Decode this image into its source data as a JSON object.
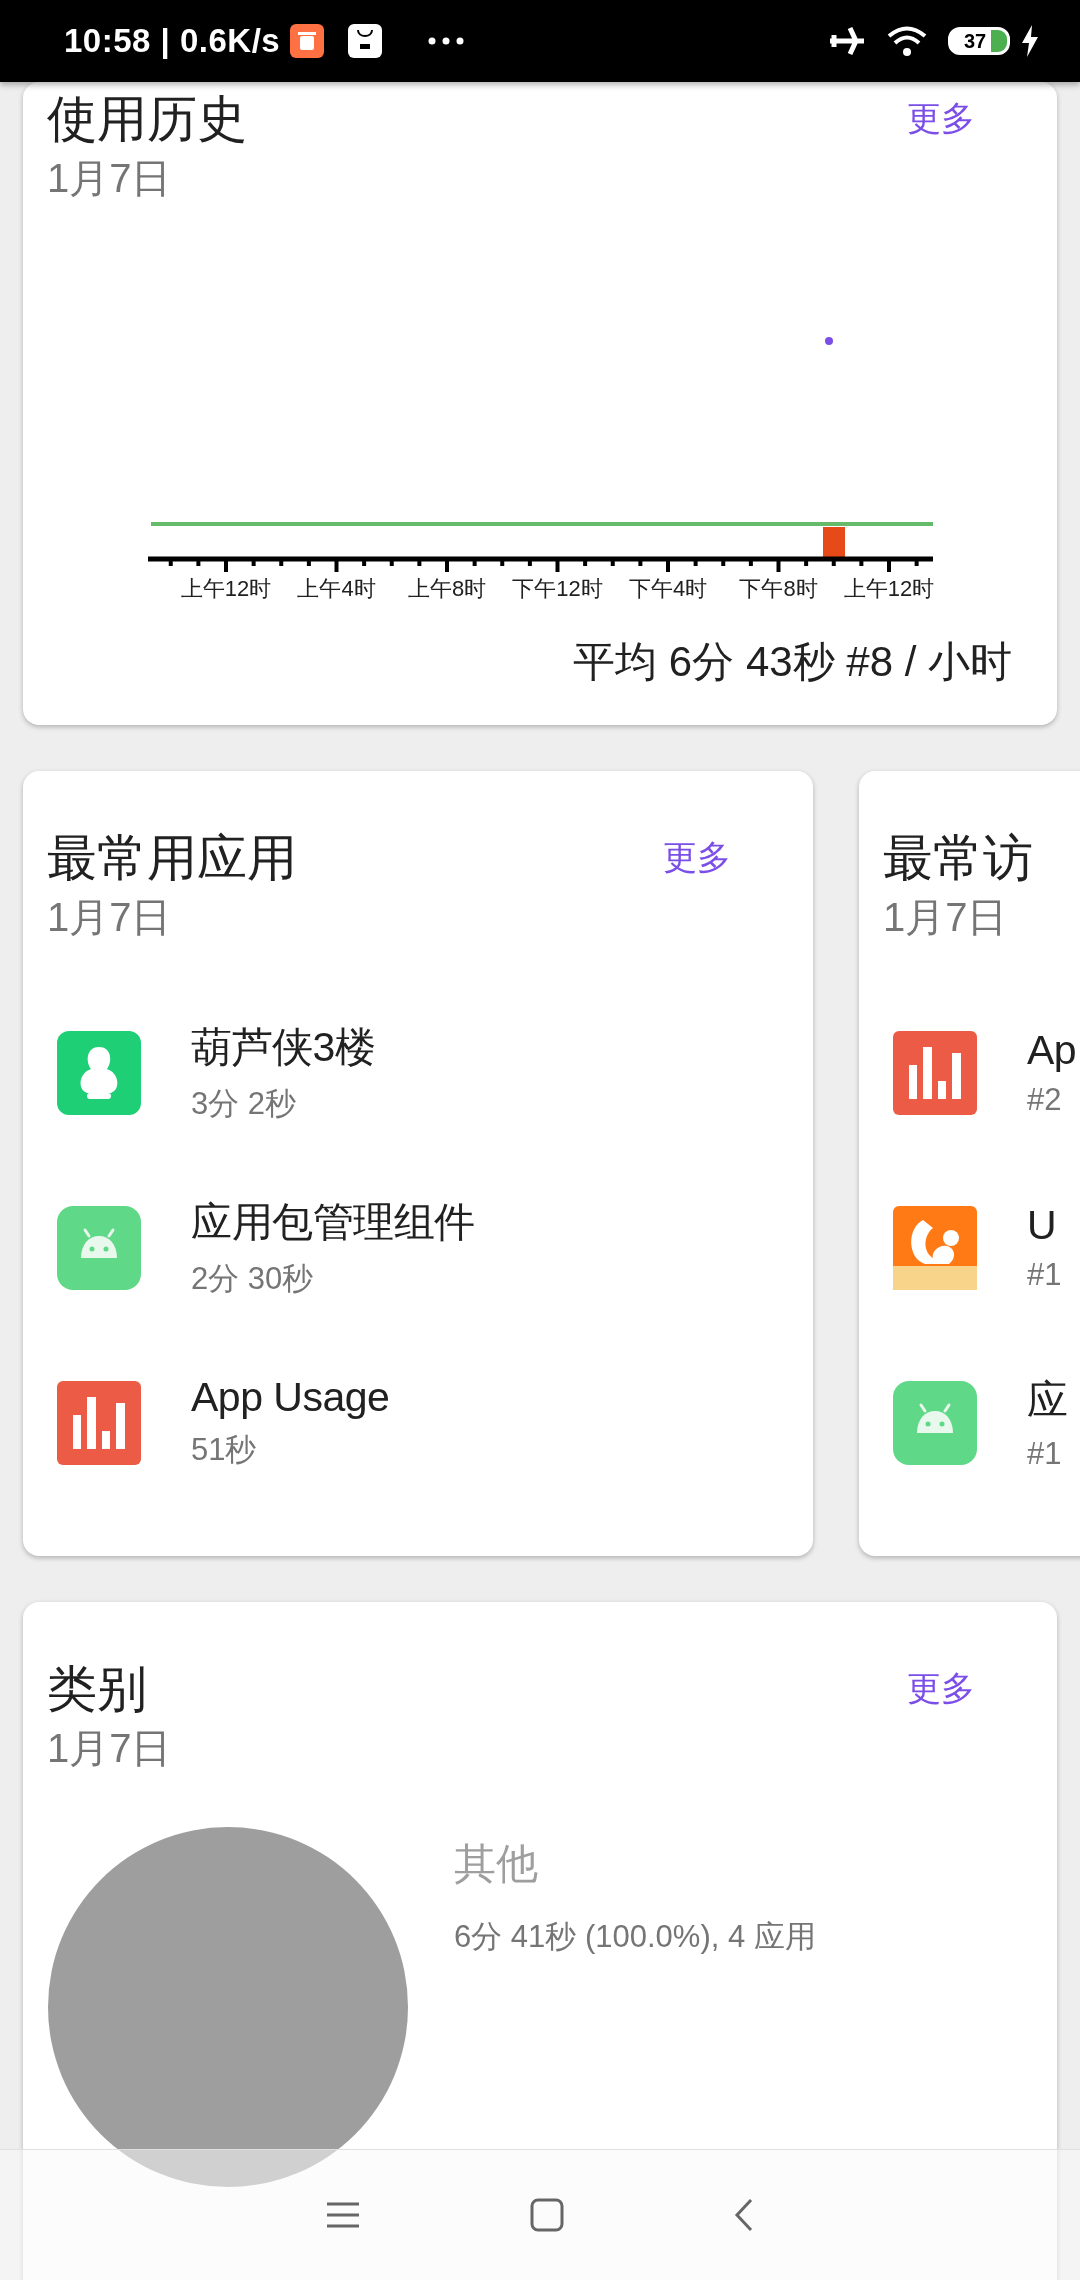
{
  "status_bar": {
    "text": "10:58 | 0.6K/s",
    "battery": "37"
  },
  "usage_history": {
    "title": "使用历史",
    "more": "更多",
    "date": "1月7日",
    "tick_labels": [
      "上午12时",
      "上午4时",
      "上午8时",
      "下午12时",
      "下午4时",
      "下午8时",
      "上午12时"
    ],
    "average": "平均 6分 43秒 #8 / 小时"
  },
  "cards": [
    {
      "title": "最常用应用",
      "more": "更多",
      "date": "1月7日",
      "apps": [
        {
          "kind": "gourd",
          "name": "葫芦侠3楼",
          "detail": "3分 2秒"
        },
        {
          "kind": "android",
          "name": "应用包管理组件",
          "detail": "2分 30秒"
        },
        {
          "kind": "bars",
          "name": "App Usage",
          "detail": "51秒"
        }
      ]
    },
    {
      "title": "最常访",
      "date": "1月7日",
      "apps": [
        {
          "kind": "bars",
          "name": "Ap",
          "detail": "#2"
        },
        {
          "kind": "squirrel",
          "name": "U",
          "detail": "#1"
        },
        {
          "kind": "android",
          "name": "应",
          "detail": "#1"
        }
      ]
    }
  ],
  "categories": {
    "title": "类别",
    "more": "更多",
    "date": "1月7日",
    "legend": [
      {
        "label": "其他",
        "detail": "6分 41秒 (100.0%), 4 应用"
      }
    ]
  }
}
